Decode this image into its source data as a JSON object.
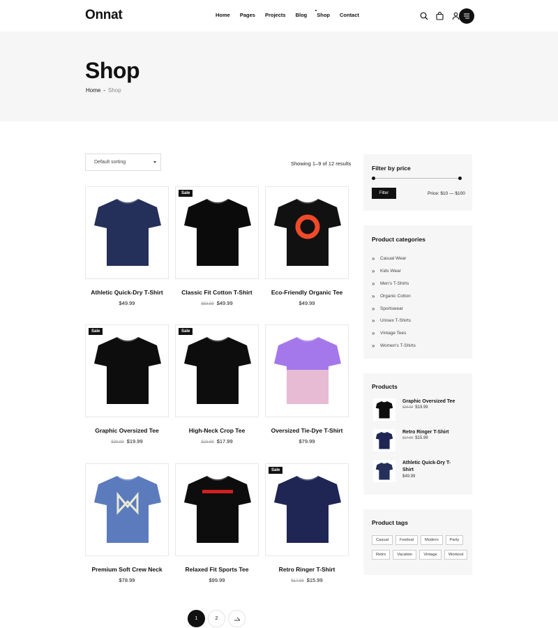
{
  "brand": {
    "logo": "Onnat"
  },
  "nav": {
    "items": [
      "Home",
      "Pages",
      "Projects",
      "Blog",
      "Shop",
      "Contact"
    ],
    "active": "Shop"
  },
  "header_icons": [
    "search-icon",
    "cart-icon",
    "user-icon",
    "menu-icon"
  ],
  "hero": {
    "title": "Shop",
    "breadcrumb": {
      "home": "Home",
      "sep": "-",
      "current": "Shop"
    }
  },
  "toolbar": {
    "sorting": "Default sorting",
    "result_count": "Showing 1–9 of 12 results"
  },
  "products": [
    {
      "name": "Athletic Quick-Dry T-Shirt",
      "price": "$49.99",
      "old_price": "",
      "sale": "",
      "shirt_color": "#24305a"
    },
    {
      "name": "Classic Fit Cotton T-Shirt",
      "price": "$49.99",
      "old_price": "$59.99",
      "sale": "Sale",
      "shirt_color": "#0b0b0b"
    },
    {
      "name": "Eco-Friendly Organic Tee",
      "price": "$49.99",
      "old_price": "",
      "sale": "",
      "shirt_color": "#111111"
    },
    {
      "name": "Graphic Oversized Tee",
      "price": "$19.99",
      "old_price": "$29.99",
      "sale": "Sale",
      "shirt_color": "#0d0d0d"
    },
    {
      "name": "High-Neck Crop Tee",
      "price": "$17.99",
      "old_price": "$23.99",
      "sale": "Sale",
      "shirt_color": "#0d0d0d"
    },
    {
      "name": "Oversized Tie-Dye T-Shirt",
      "price": "$79.99",
      "old_price": "",
      "sale": "",
      "shirt_color": "#a478ea"
    },
    {
      "name": "Premium Soft Crew Neck",
      "price": "$78.99",
      "old_price": "",
      "sale": "",
      "shirt_color": "#5c7bbd"
    },
    {
      "name": "Relaxed Fit Sports Tee",
      "price": "$99.99",
      "old_price": "",
      "sale": "",
      "shirt_color": "#0d0d0d"
    },
    {
      "name": "Retro Ringer T-Shirt",
      "price": "$15.99",
      "old_price": "$17.99",
      "sale": "Sale",
      "shirt_color": "#1f2654"
    }
  ],
  "pagination": {
    "pages": [
      "1",
      "2"
    ],
    "active": "1",
    "next_icon": "arrow-right-icon"
  },
  "sidebar": {
    "price_filter": {
      "title": "Filter by price",
      "button": "Filter",
      "range": "Price: $10 — $100"
    },
    "categories": {
      "title": "Product categories",
      "items": [
        "Casual Wear",
        "Kids Wear",
        "Men's T-Shirts",
        "Organic Cotton",
        "Sportswear",
        "Unisex T-Shirts",
        "Vintage Tees",
        "Women's T-Shirts"
      ]
    },
    "products": {
      "title": "Products",
      "items": [
        {
          "name": "Graphic Oversized Tee",
          "old_price": "$29.99",
          "price": "$19.99",
          "shirt_color": "#0d0d0d"
        },
        {
          "name": "Retro Ringer T-Shirt",
          "old_price": "$17.99",
          "price": "$15.99",
          "shirt_color": "#1f2654"
        },
        {
          "name": "Athletic Quick-Dry T-Shirt",
          "old_price": "",
          "price": "$49.99",
          "shirt_color": "#24305a"
        }
      ]
    },
    "tags": {
      "title": "Product tags",
      "items": [
        "Casual",
        "Festival",
        "Modern",
        "Party",
        "Retro",
        "Vacation",
        "Vintage",
        "Workout"
      ]
    }
  }
}
